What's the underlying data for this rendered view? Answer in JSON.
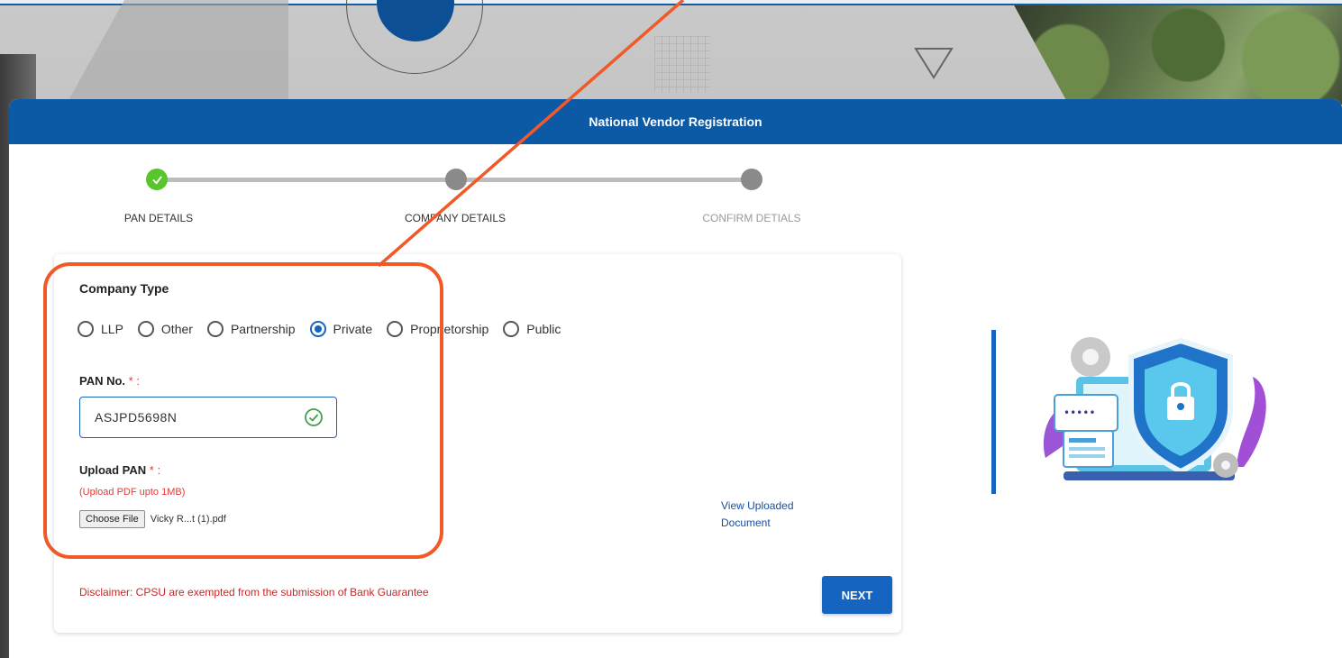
{
  "header": {
    "title": "National Vendor Registration"
  },
  "stepper": {
    "steps": [
      {
        "label": "PAN DETAILS",
        "state": "completed"
      },
      {
        "label": "COMPANY DETAILS",
        "state": "pending"
      },
      {
        "label": "CONFIRM DETIALS",
        "state": "pending"
      }
    ]
  },
  "form": {
    "company_type": {
      "label": "Company Type",
      "options": [
        "LLP",
        "Other",
        "Partnership",
        "Private",
        "Proprietorship",
        "Public"
      ],
      "selected": "Private"
    },
    "pan": {
      "label": "PAN No.",
      "required_mark": "* :",
      "value": "ASJPD5698N",
      "status_icon": "check-circle-icon"
    },
    "upload": {
      "label": "Upload PAN",
      "required_mark": "* :",
      "hint": "(Upload PDF upto 1MB)",
      "button_label": "Choose File",
      "file_name": "Vicky R...t (1).pdf",
      "view_link": "View Uploaded Document"
    },
    "disclaimer": "Disclaimer: CPSU are exempted from the submission of Bank Guarantee",
    "next_label": "NEXT"
  },
  "colors": {
    "header_blue": "#0c5aa6",
    "primary": "#1565c0",
    "step_done": "#58c52a",
    "step_pending": "#8a8a8a",
    "error_red": "#e53935",
    "annotation": "#f05a28"
  }
}
